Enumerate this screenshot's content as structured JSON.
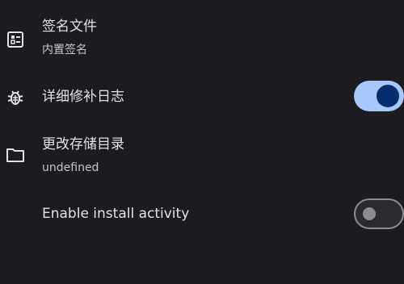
{
  "settings": {
    "signature": {
      "title": "签名文件",
      "subtitle": "内置签名",
      "icon": "list-card-icon"
    },
    "verbose_log": {
      "title": "详细修补日志",
      "icon": "bug-icon",
      "enabled": true
    },
    "storage_dir": {
      "title": "更改存储目录",
      "subtitle": "undefined",
      "icon": "folder-icon"
    },
    "install_activity": {
      "title": "Enable install activity",
      "enabled": false
    }
  },
  "colors": {
    "background": "#1c1b1f",
    "switch_on_track": "#a8c7fa",
    "switch_on_thumb": "#062e6f",
    "switch_off_outline": "#8e8c92"
  }
}
